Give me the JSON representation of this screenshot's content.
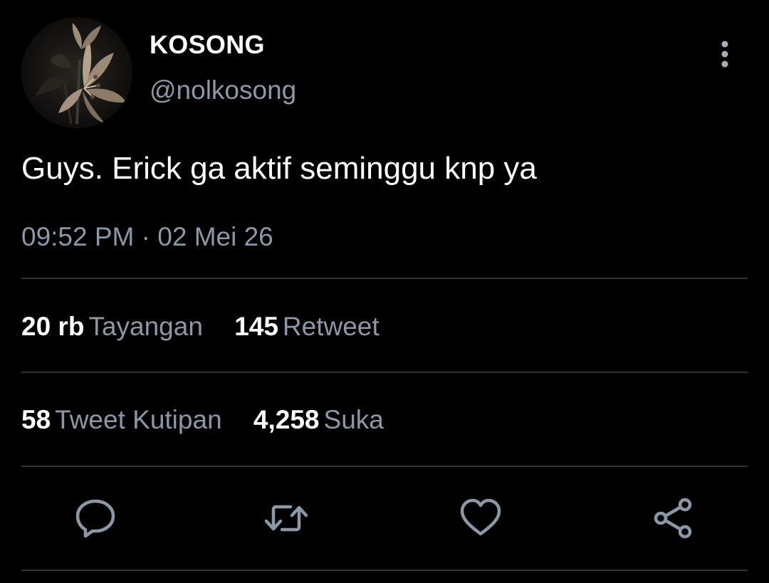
{
  "author": {
    "display_name": "KOSONG",
    "handle": "@nolkosong"
  },
  "tweet": {
    "text": "Guys. Erick ga aktif seminggu knp ya",
    "time": "09:52 PM",
    "separator": "·",
    "date": "02 Mei 26"
  },
  "stats": {
    "views_count": "20 rb",
    "views_label": "Tayangan",
    "retweets_count": "145",
    "retweets_label": "Retweet",
    "quotes_count": "58",
    "quotes_label": "Tweet Kutipan",
    "likes_count": "4,258",
    "likes_label": "Suka"
  },
  "icons": {
    "avatar": "lily-flower-avatar",
    "more": "more-vertical-icon",
    "reply": "reply-icon",
    "retweet": "retweet-icon",
    "like": "heart-icon",
    "share": "share-icon"
  },
  "colors": {
    "background": "#000000",
    "primary_text": "#ffffff",
    "secondary_text": "#8b98a5",
    "divider": "#2f3336"
  }
}
